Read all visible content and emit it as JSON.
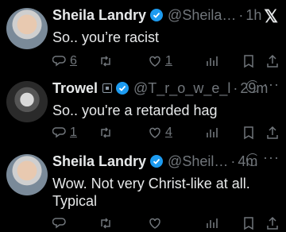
{
  "tweets": [
    {
      "name": "Sheila Landry",
      "handle": "@Sheila…",
      "time": "1h",
      "text": "So.. you’re racist",
      "replies": "6",
      "likes": "1",
      "corner": "x-logo"
    },
    {
      "name": "Trowel",
      "handle": "@T_r_o_w_e_l",
      "time": "29m",
      "text": "So.. you're a retarded hag",
      "replies": "1",
      "likes": "4",
      "corner": "more"
    },
    {
      "name": "Sheila Landry",
      "handle": "@Sheil…",
      "time": "4m",
      "text": "Wow. Not very Christ-like at all. Typical",
      "corner": "more"
    }
  ],
  "colors": {
    "background": "#000000",
    "text": "#e7e9ea",
    "muted": "#71767b",
    "verified": "#1d9bf0"
  },
  "separator": "·",
  "icons": [
    "reply-icon",
    "retweet-icon",
    "like-icon",
    "views-icon",
    "bookmark-icon",
    "share-icon"
  ]
}
